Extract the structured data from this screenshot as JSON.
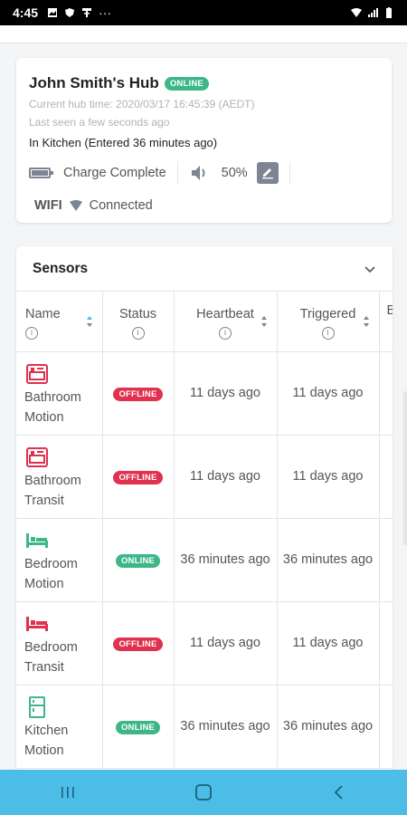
{
  "status_bar": {
    "time": "4:45",
    "dots": "···"
  },
  "hub": {
    "name": "John Smith's Hub",
    "status_badge": "ONLINE",
    "hub_time": "Current hub time: 2020/03/17 16:45:39 (AEDT)",
    "last_seen": "Last seen a few seconds ago",
    "location": "In Kitchen (Entered 36 minutes ago)",
    "battery_text": "Charge Complete",
    "volume_text": "50%",
    "wifi_label": "WIFI",
    "wifi_status": "Connected"
  },
  "sensors": {
    "title": "Sensors",
    "columns": [
      "Name",
      "Status",
      "Heartbeat",
      "Triggered",
      "B"
    ],
    "rows": [
      {
        "name": "Bathroom Motion",
        "status": "OFFLINE",
        "heartbeat": "11 days ago",
        "triggered": "11 days ago"
      },
      {
        "name": "Bathroom Transit",
        "status": "OFFLINE",
        "heartbeat": "11 days ago",
        "triggered": "11 days ago"
      },
      {
        "name": "Bedroom Motion",
        "status": "ONLINE",
        "heartbeat": "36 minutes ago",
        "triggered": "36 minutes ago"
      },
      {
        "name": "Bedroom Transit",
        "status": "OFFLINE",
        "heartbeat": "11 days ago",
        "triggered": "11 days ago"
      },
      {
        "name": "Kitchen Motion",
        "status": "ONLINE",
        "heartbeat": "36 minutes ago",
        "triggered": "36 minutes ago"
      }
    ]
  },
  "colors": {
    "online": "#3db788",
    "offline": "#e0314f",
    "nav": "#4bbde6"
  },
  "icons": {
    "bath": "bathtub-icon",
    "bed": "bed-icon",
    "fridge": "fridge-icon"
  }
}
